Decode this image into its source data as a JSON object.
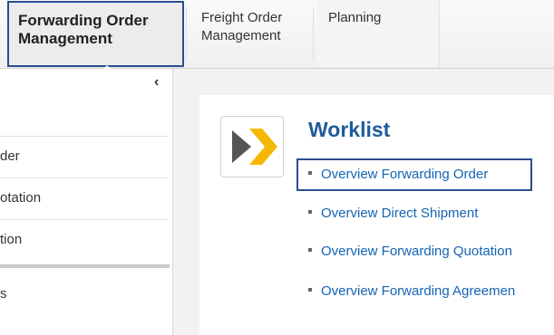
{
  "tabs": [
    {
      "label_line1": "Forwarding Order",
      "label_line2": "Management"
    },
    {
      "label_line1": "Freight Order",
      "label_line2": "Management"
    },
    {
      "label_line1": "Planning",
      "label_line2": ""
    }
  ],
  "sidebar": {
    "collapse_glyph": "‹",
    "items": [
      {
        "label": "der"
      },
      {
        "label": "otation"
      },
      {
        "label": "tion"
      }
    ],
    "trailing_text": "s"
  },
  "worklist": {
    "title": "Worklist",
    "links": [
      {
        "label": "Overview Forwarding Order"
      },
      {
        "label": "Overview Direct Shipment"
      },
      {
        "label": "Overview Forwarding Quotation"
      },
      {
        "label": "Overview Forwarding Agreemen"
      }
    ]
  },
  "colors": {
    "accent_blue": "#1f5b9a",
    "link_blue": "#1464b4",
    "highlight_border": "#2a4d8f",
    "arrow_gray": "#555555",
    "arrow_yellow": "#f5b800"
  },
  "icons": {
    "app_icon": "forward-arrows-icon"
  }
}
